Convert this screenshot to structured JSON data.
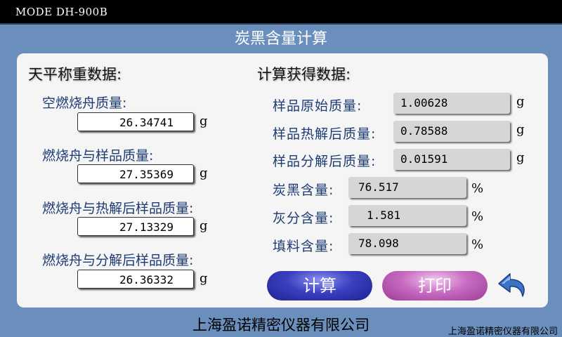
{
  "mode": "MODE DH-900B",
  "title": "炭黑含量计算",
  "left": {
    "heading": "天平称重数据:",
    "fields": [
      {
        "label": "空燃烧舟质量:",
        "value": "26.34741",
        "unit": "g"
      },
      {
        "label": "燃烧舟与样品质量:",
        "value": "27.35369",
        "unit": "g"
      },
      {
        "label": "燃烧舟与热解后样品质量:",
        "value": "27.13329",
        "unit": "g"
      },
      {
        "label": "燃烧舟与分解后样品质量:",
        "value": "26.36332",
        "unit": "g"
      }
    ]
  },
  "right": {
    "heading": "计算获得数据:",
    "masses": [
      {
        "label": "样品原始质量:",
        "value": "1.00628",
        "unit": "g"
      },
      {
        "label": "样品热解后质量:",
        "value": "0.78588",
        "unit": "g"
      },
      {
        "label": "样品分解后质量:",
        "value": "0.01591",
        "unit": "g"
      }
    ],
    "contents": [
      {
        "label": "炭黑含量:",
        "value": "76.517",
        "unit": "%"
      },
      {
        "label": "灰分含量:",
        "value": "1.581",
        "unit": "%"
      },
      {
        "label": "填料含量:",
        "value": "78.098",
        "unit": "%"
      }
    ]
  },
  "buttons": {
    "calculate": "计算",
    "print": "打印"
  },
  "icons": {
    "back": "back-arrow-icon"
  },
  "colors": {
    "background": "#6b8fbd",
    "label": "#1d3b74",
    "calc_button": "#3a3fc0",
    "print_button": "#c76ac0",
    "back_arrow": "#3b73c8"
  },
  "footer": {
    "company": "上海盈诺精密仪器有限公司",
    "company_small": "上海盈诺精密仪器有限公司"
  }
}
